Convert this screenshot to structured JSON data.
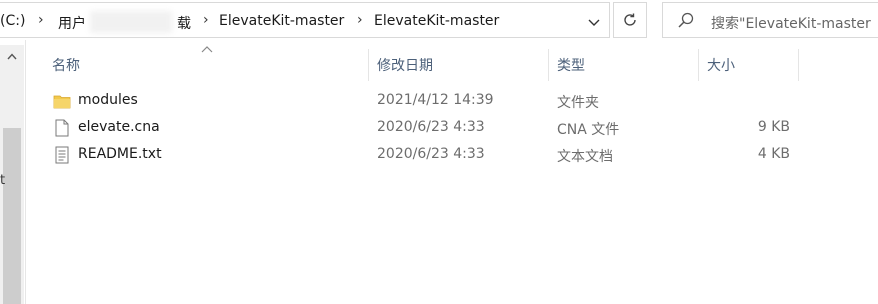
{
  "address": {
    "drive_partial": "(C:)",
    "user_partial": "用户",
    "folder_partial": "载",
    "crumbs": [
      "ElevateKit-master",
      "ElevateKit-master"
    ]
  },
  "search": {
    "placeholder": "搜索\"ElevateKit-master"
  },
  "columns": {
    "name": "名称",
    "date": "修改日期",
    "type": "类型",
    "size": "大小"
  },
  "files": [
    {
      "name": "modules",
      "date": "2021/4/12 14:39",
      "type": "文件夹",
      "size": "",
      "icon": "folder-icon"
    },
    {
      "name": "elevate.cna",
      "date": "2020/6/23 4:33",
      "type": "CNA 文件",
      "size": "9 KB",
      "icon": "file-icon"
    },
    {
      "name": "README.txt",
      "date": "2020/6/23 4:33",
      "type": "文本文档",
      "size": "4 KB",
      "icon": "text-file-icon"
    }
  ],
  "sidebar": {
    "edge_glyph": "t"
  },
  "colors": {
    "header_text": "#4c607a",
    "folder": "#f2c94c",
    "meta_text": "#6d6d6d"
  }
}
